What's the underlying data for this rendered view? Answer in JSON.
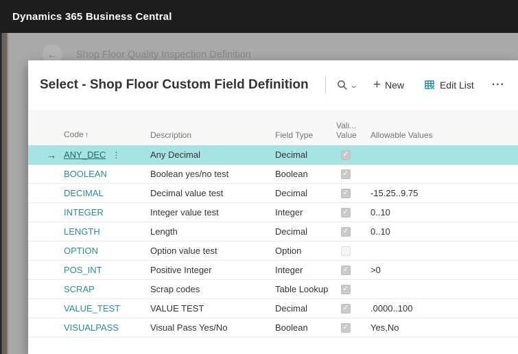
{
  "app": {
    "title": "Dynamics 365 Business Central"
  },
  "breadcrumb": {
    "label": "Shop Floor Quality Inspection Definition"
  },
  "icons": {
    "back": "←",
    "chevron_down": "⌄",
    "plus": "+",
    "more": "···",
    "sort_up": "↑",
    "row_marker": "→",
    "row_dots": "⋮",
    "check": "✓"
  },
  "colors": {
    "accent_teal": "#2e8c8c",
    "selected_row": "#a6e3e3",
    "editlist_icon": "#077e7e",
    "topbar_bg": "#1d1d1d"
  },
  "dialog": {
    "title": "Select - Shop Floor Custom Field Definition",
    "toolbar": {
      "new_label": "New",
      "edit_list_label": "Edit List"
    }
  },
  "table": {
    "headers": {
      "code": "Code",
      "description": "Description",
      "field_type": "Field Type",
      "validate_line1": "Vali...",
      "validate_line2": "Value",
      "allowable": "Allowable Values"
    },
    "selected_index": 0,
    "rows": [
      {
        "code": "ANY_DEC",
        "description": "Any Decimal",
        "field_type": "Decimal",
        "validate": true,
        "allowable": ""
      },
      {
        "code": "BOOLEAN",
        "description": "Boolean yes/no test",
        "field_type": "Boolean",
        "validate": true,
        "allowable": ""
      },
      {
        "code": "DECIMAL",
        "description": "Decimal value test",
        "field_type": "Decimal",
        "validate": true,
        "allowable": "-15.25..9.75"
      },
      {
        "code": "INTEGER",
        "description": "Integer value test",
        "field_type": "Integer",
        "validate": true,
        "allowable": "0..10"
      },
      {
        "code": "LENGTH",
        "description": "Length",
        "field_type": "Decimal",
        "validate": true,
        "allowable": "0..10"
      },
      {
        "code": "OPTION",
        "description": "Option value test",
        "field_type": "Option",
        "validate": false,
        "allowable": ""
      },
      {
        "code": "POS_INT",
        "description": "Positive Integer",
        "field_type": "Integer",
        "validate": true,
        "allowable": ">0"
      },
      {
        "code": "SCRAP",
        "description": "Scrap codes",
        "field_type": "Table Lookup",
        "validate": true,
        "allowable": ""
      },
      {
        "code": "VALUE_TEST",
        "description": "VALUE TEST",
        "field_type": "Decimal",
        "validate": true,
        "allowable": ".0000..100"
      },
      {
        "code": "VISUALPASS",
        "description": "Visual Pass Yes/No",
        "field_type": "Boolean",
        "validate": true,
        "allowable": "Yes,No"
      }
    ]
  }
}
